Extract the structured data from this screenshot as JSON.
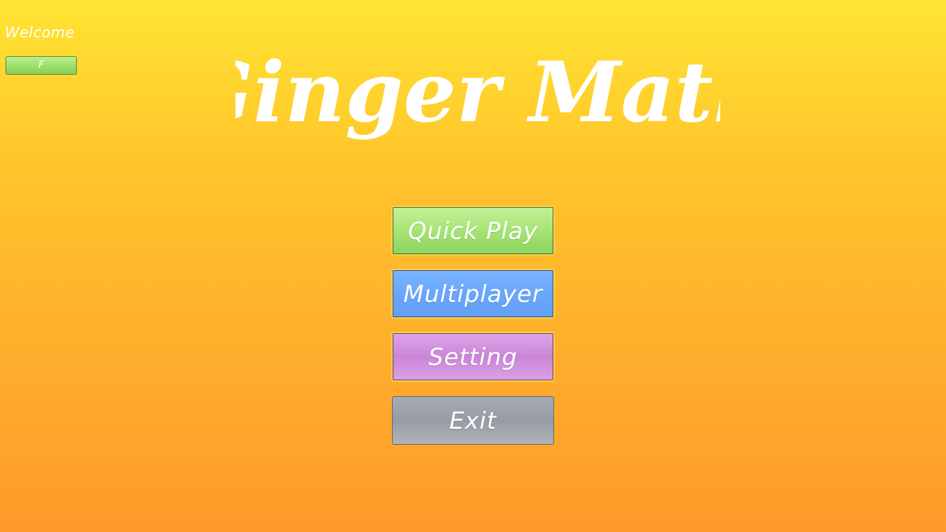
{
  "header": {
    "welcome_text": "Welcome",
    "user_badge_label": "F"
  },
  "title": {
    "text": "Ginger Math"
  },
  "menu": {
    "quick_play_label": "Quick Play",
    "multiplayer_label": "Multiplayer",
    "setting_label": "Setting",
    "exit_label": "Exit"
  },
  "colors": {
    "background_top": "#ffe433",
    "background_bottom": "#ff9a2a",
    "quick_play": "#a6e474",
    "multiplayer": "#6aa6fa",
    "setting": "#c986d6",
    "exit": "#979ca4",
    "button_outline": "#f5d44a"
  }
}
